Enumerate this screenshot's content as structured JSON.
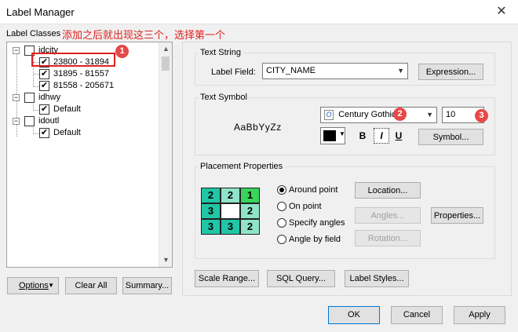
{
  "window": {
    "title": "Label Manager",
    "close_glyph": "✕"
  },
  "annotation": "添加之后就出现这三个，选择第一个",
  "label_classes": {
    "heading": "Label Classes",
    "tree": [
      {
        "name": "idcity",
        "expander": "−",
        "children": [
          "23800 - 31894",
          "31895 - 81557",
          "81558 - 205671"
        ]
      },
      {
        "name": "idhwy",
        "expander": "−",
        "children": [
          "Default"
        ]
      },
      {
        "name": "idoutl",
        "expander": "−",
        "children": [
          "Default"
        ]
      }
    ],
    "check": "✔"
  },
  "left_buttons": {
    "options": "Options",
    "clear_all": "Clear All",
    "summary": "Summary..."
  },
  "text_string": {
    "group_title": "Text String",
    "label_field_label": "Label Field:",
    "label_field_value": "CITY_NAME",
    "expression_button": "Expression..."
  },
  "text_symbol": {
    "group_title": "Text Symbol",
    "preview": "AaBbYyZz",
    "font_icon": "O",
    "font_name": "Century Gothic",
    "font_size": "10",
    "bold": "B",
    "italic": "I",
    "underline": "U",
    "symbol_button": "Symbol...",
    "color": "#000000"
  },
  "placement": {
    "group_title": "Placement Properties",
    "grid": [
      "2",
      "2",
      "1",
      "3",
      "",
      "2",
      "3",
      "3",
      "2"
    ],
    "grid_colors": {
      "dark": "#21c6a6",
      "light": "#8fe3c9",
      "green": "#39d45a",
      "white": "#ffffff"
    },
    "options": [
      "Around point",
      "On point",
      "Specify angles",
      "Angle by field"
    ],
    "location_button": "Location...",
    "angles_button": "Angles...",
    "rotation_button": "Rotation...",
    "properties_button": "Properties..."
  },
  "bottom_buttons": {
    "scale_range": "Scale Range...",
    "sql_query": "SQL Query...",
    "label_styles": "Label Styles..."
  },
  "dialog_buttons": {
    "ok": "OK",
    "cancel": "Cancel",
    "apply": "Apply"
  },
  "badges": [
    "1",
    "2",
    "3"
  ],
  "colors": {
    "annotation_red": "#e02020",
    "badge_red": "#e84848",
    "accent_blue": "#0078d7"
  }
}
